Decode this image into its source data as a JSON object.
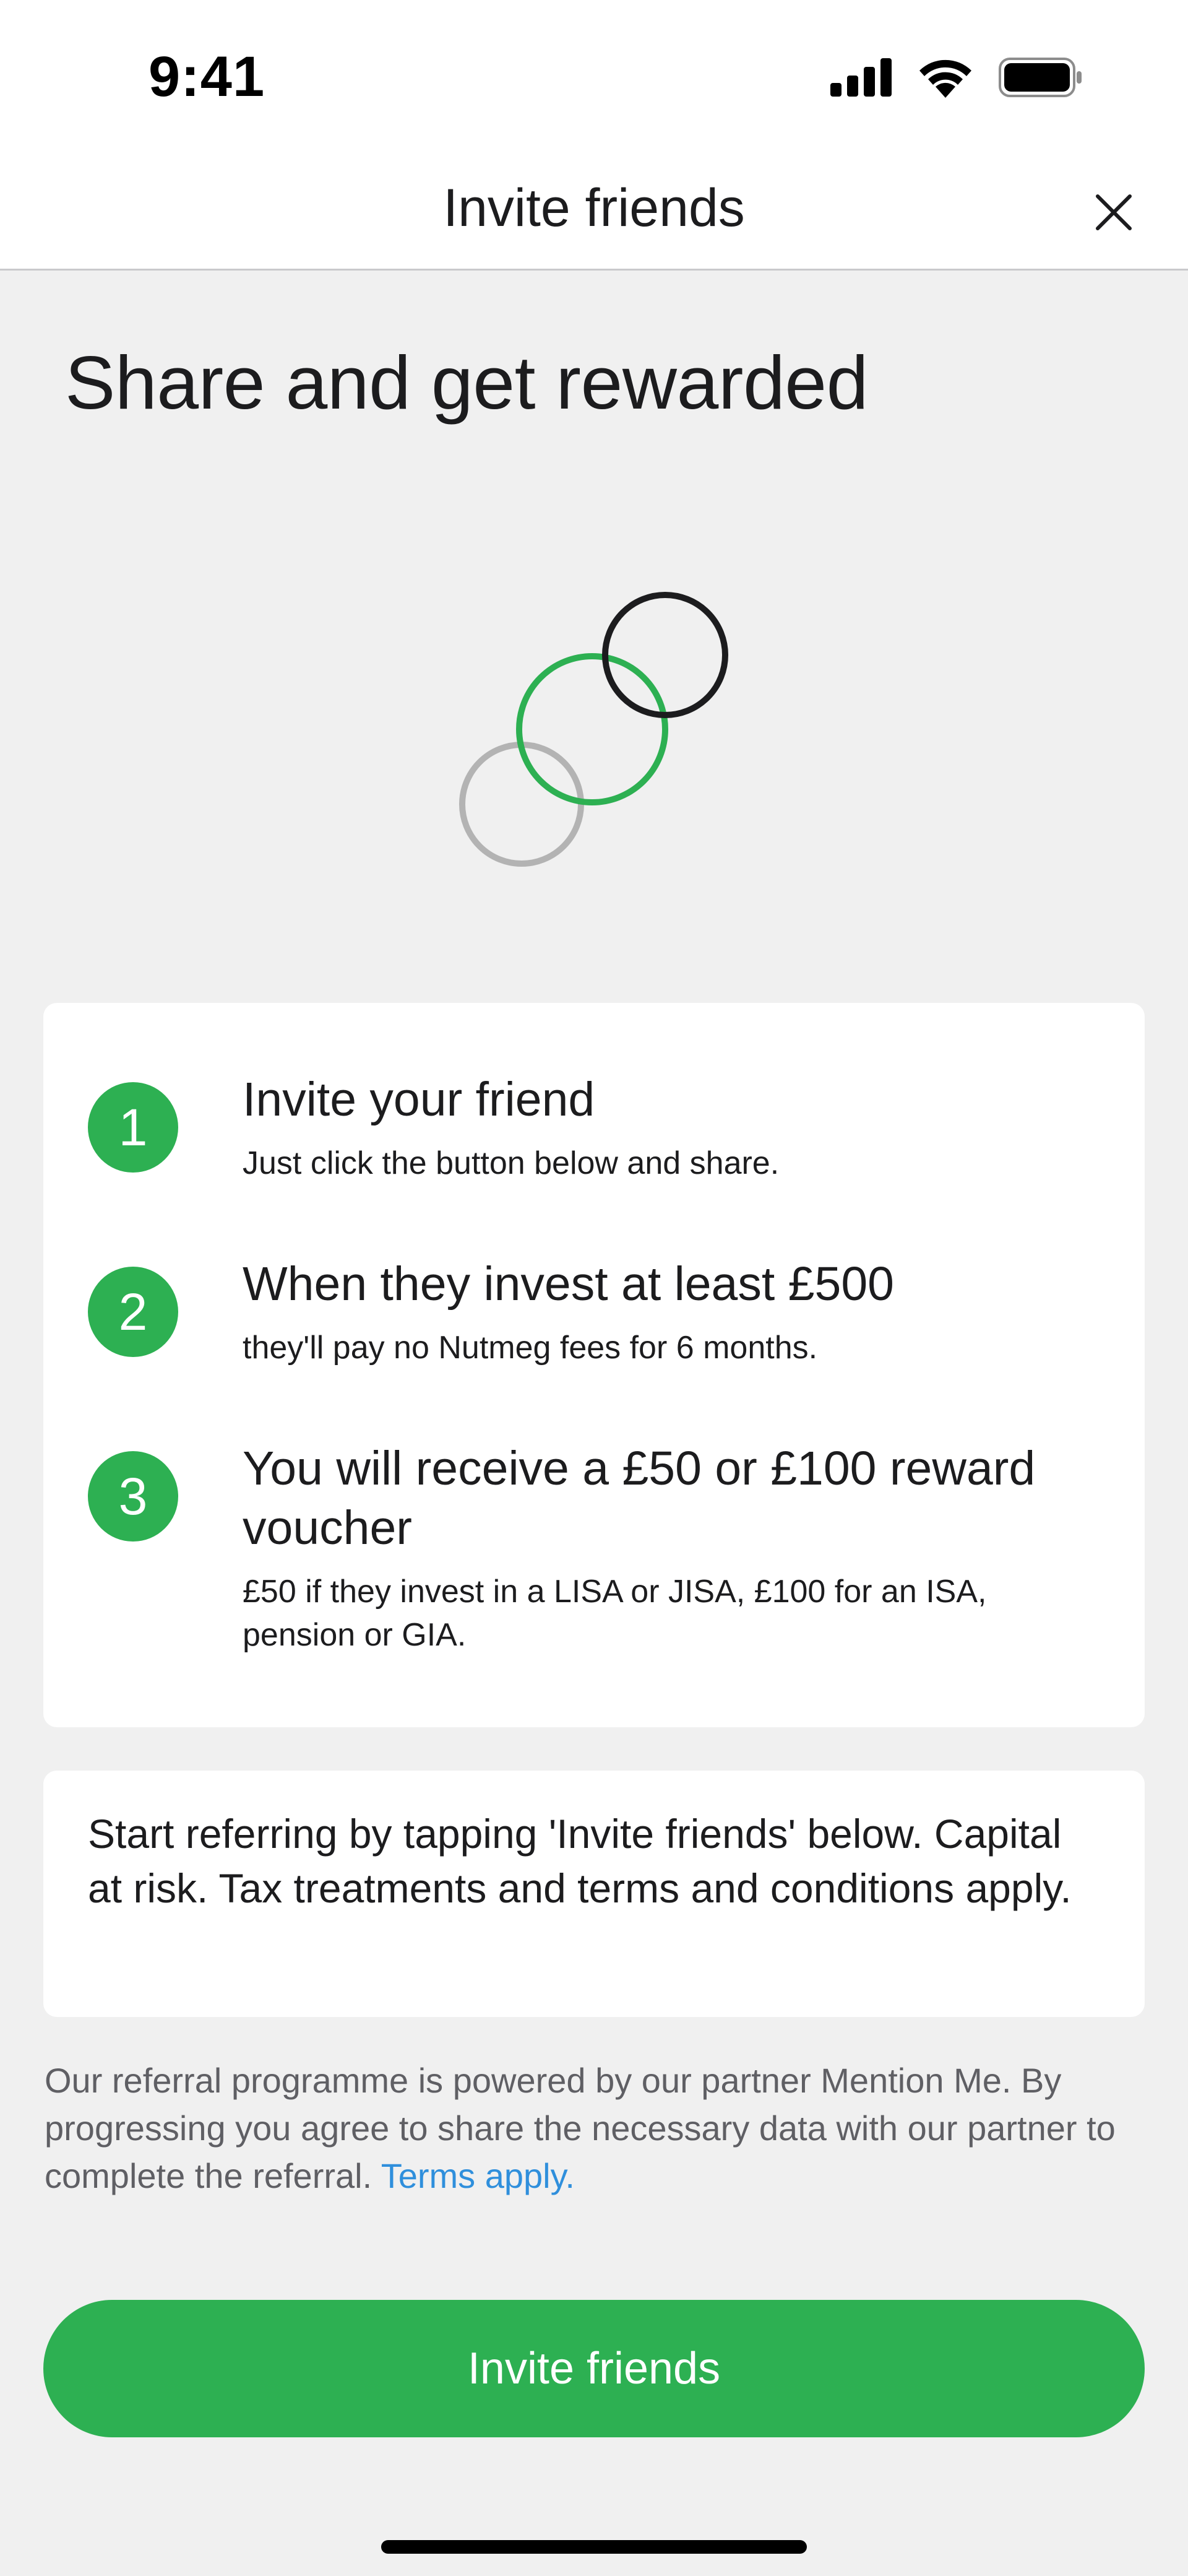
{
  "status_bar": {
    "time": "9:41",
    "icons": [
      "cellular-signal-icon",
      "wifi-icon",
      "battery-icon"
    ]
  },
  "header": {
    "title": "Invite friends",
    "close_icon": "close-icon"
  },
  "headline": "Share and get rewarded",
  "illustration": {
    "icon": "linked-circles-icon",
    "colors": [
      "#b3b3b3",
      "#2db052",
      "#1c1c1e"
    ]
  },
  "steps": [
    {
      "number": "1",
      "title": "Invite your friend",
      "description": "Just click the button below and share."
    },
    {
      "number": "2",
      "title": "When they invest at least £500",
      "description": "they'll pay no Nutmeg fees for 6 months."
    },
    {
      "number": "3",
      "title": "You will receive a £50 or £100 reward voucher",
      "description": "£50 if they invest in a LISA or JISA, £100 for an ISA, pension or GIA."
    }
  ],
  "notice": "Start referring by tapping 'Invite friends' below. Capital at risk. Tax treatments and terms and conditions apply.",
  "disclaimer": {
    "text": "Our referral programme is powered by our partner Mention Me. By progressing you agree to share the necessary data with our partner to complete the referral.",
    "link_label": "Terms apply."
  },
  "primary_button": {
    "label": "Invite friends"
  },
  "colors": {
    "accent_green": "#2db052",
    "link_blue": "#2f8fdc",
    "background": "#f0f0f0",
    "card": "#ffffff"
  }
}
